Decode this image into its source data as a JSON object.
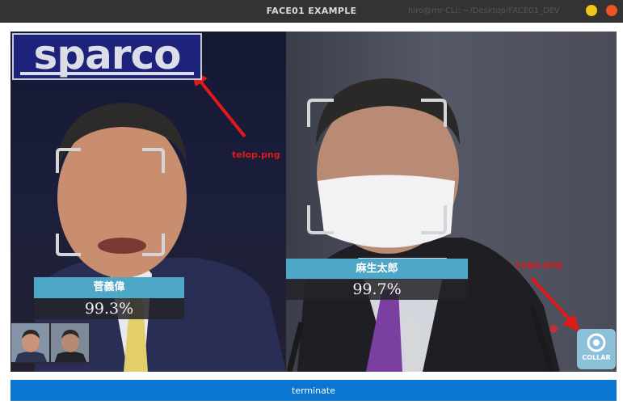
{
  "window": {
    "title": "FACE01 EXAMPLE",
    "background_title": "hiro@mr-CLI: ~/Desktop/FACE01_DEV"
  },
  "video": {
    "logo_text": "sparco",
    "annotation_telop": "telop.png",
    "annotation_logo": "Logo.png",
    "collar_logo_text": "COLLAR",
    "faces": [
      {
        "name": "菅義偉",
        "score": "99.3%"
      },
      {
        "name": "麻生太郎",
        "score": "99.7%"
      }
    ]
  },
  "controls": {
    "terminate_label": "terminate"
  },
  "colors": {
    "name_bar": "#4ea7c7",
    "terminate_button": "#0b76d1",
    "annotation": "#e01919"
  }
}
